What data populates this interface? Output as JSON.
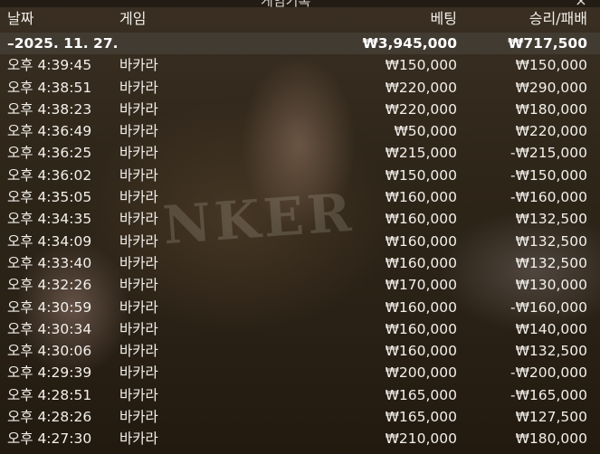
{
  "window": {
    "title": "게임기록",
    "close_label": "×"
  },
  "watermark_text": "NKER",
  "table": {
    "headers": {
      "date": "날짜",
      "game": "게임",
      "bet": "베팅",
      "win_loss": "승리/패배"
    },
    "summary": {
      "date": "–2025. 11. 27.",
      "bet": "₩3,945,000",
      "win_loss": "₩717,500"
    },
    "rows": [
      {
        "time": "오후 4:39:45",
        "game": "바카라",
        "bet": "₩150,000",
        "result": "₩150,000"
      },
      {
        "time": "오후 4:38:51",
        "game": "바카라",
        "bet": "₩220,000",
        "result": "₩290,000"
      },
      {
        "time": "오후 4:38:23",
        "game": "바카라",
        "bet": "₩220,000",
        "result": "₩180,000"
      },
      {
        "time": "오후 4:36:49",
        "game": "바카라",
        "bet": "₩50,000",
        "result": "₩220,000"
      },
      {
        "time": "오후 4:36:25",
        "game": "바카라",
        "bet": "₩215,000",
        "result": "-₩215,000"
      },
      {
        "time": "오후 4:36:02",
        "game": "바카라",
        "bet": "₩150,000",
        "result": "-₩150,000"
      },
      {
        "time": "오후 4:35:05",
        "game": "바카라",
        "bet": "₩160,000",
        "result": "-₩160,000"
      },
      {
        "time": "오후 4:34:35",
        "game": "바카라",
        "bet": "₩160,000",
        "result": "₩132,500"
      },
      {
        "time": "오후 4:34:09",
        "game": "바카라",
        "bet": "₩160,000",
        "result": "₩132,500"
      },
      {
        "time": "오후 4:33:40",
        "game": "바카라",
        "bet": "₩160,000",
        "result": "₩132,500"
      },
      {
        "time": "오후 4:32:26",
        "game": "바카라",
        "bet": "₩170,000",
        "result": "₩130,000"
      },
      {
        "time": "오후 4:30:59",
        "game": "바카라",
        "bet": "₩160,000",
        "result": "-₩160,000"
      },
      {
        "time": "오후 4:30:34",
        "game": "바카라",
        "bet": "₩160,000",
        "result": "₩140,000"
      },
      {
        "time": "오후 4:30:06",
        "game": "바카라",
        "bet": "₩160,000",
        "result": "₩132,500"
      },
      {
        "time": "오후 4:29:39",
        "game": "바카라",
        "bet": "₩200,000",
        "result": "-₩200,000"
      },
      {
        "time": "오후 4:28:51",
        "game": "바카라",
        "bet": "₩165,000",
        "result": "-₩165,000"
      },
      {
        "time": "오후 4:28:26",
        "game": "바카라",
        "bet": "₩165,000",
        "result": "₩127,500"
      },
      {
        "time": "오후 4:27:30",
        "game": "바카라",
        "bet": "₩210,000",
        "result": "₩180,000"
      }
    ]
  }
}
